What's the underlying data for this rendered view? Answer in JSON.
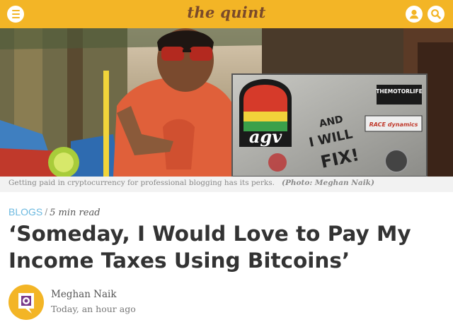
{
  "header": {
    "logo": "the quint",
    "menu_icon": "hamburger-menu-icon",
    "user_icon": "user-icon",
    "search_icon": "search-icon",
    "brand_color": "#f3b526"
  },
  "hero": {
    "caption": "Getting paid in cryptocurrency for professional blogging has its perks.",
    "credit": "(Photo: Meghan Naik)",
    "board_texts": [
      "THEMOTORLIFE",
      "RACE dynamics",
      "agv",
      "AND I WILL FIX!"
    ]
  },
  "article": {
    "category": "BLOGS",
    "separator": "/",
    "read_time": "5 min read",
    "headline_line1": "‘Someday, I Would Love to Pay My",
    "headline_line2": "Income Taxes Using Bitcoins’",
    "author": "Meghan Naik",
    "timestamp": "Today, an hour ago",
    "category_color": "#6bb9e0"
  }
}
